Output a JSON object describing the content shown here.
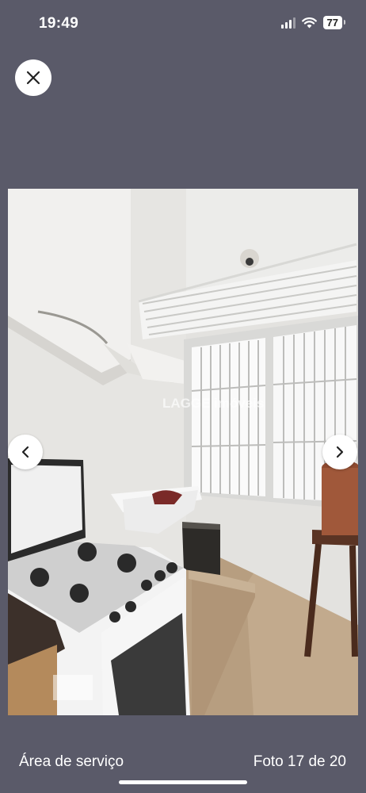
{
  "status": {
    "time": "19:49",
    "battery": "77"
  },
  "gallery": {
    "caption": "Área de serviço",
    "counter": "Foto 17 de 20",
    "watermark": "LAGGE imóveis"
  },
  "icons": {
    "close": "close-icon",
    "prev": "chevron-left-icon",
    "next": "chevron-right-icon",
    "signal": "cellular-signal-icon",
    "wifi": "wifi-icon"
  }
}
